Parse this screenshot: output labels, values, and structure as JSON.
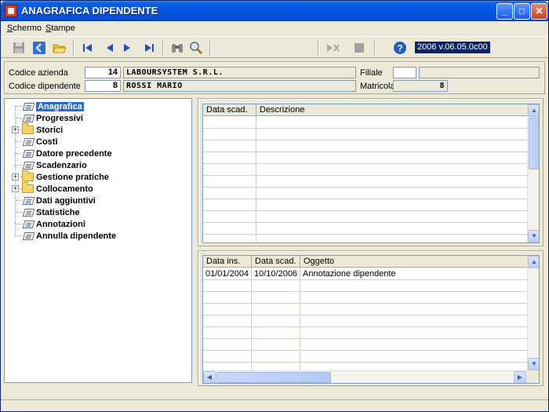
{
  "window": {
    "title": "ANAGRAFICA DIPENDENTE"
  },
  "menu": {
    "items": [
      {
        "label": "Schermo",
        "accel": "S",
        "rest": "chermo"
      },
      {
        "label": "Stampe",
        "accel": "S",
        "rest": "tampe"
      }
    ]
  },
  "toolbar": {
    "version": "2006 v.06.05.0c00"
  },
  "header": {
    "codice_azienda_label": "Codice azienda",
    "codice_azienda_value": "14",
    "azienda_name": "LABOURSYSTEM S.R.L.",
    "codice_dipendente_label": "Codice dipendente",
    "codice_dipendente_value": "8",
    "dipendente_name": "ROSSI MARIO",
    "filiale_label": "Filiale",
    "filiale_value": "",
    "filiale_desc": "",
    "matricola_label": "Matricola",
    "matricola_value": "8"
  },
  "tree": {
    "items": [
      {
        "label": "Anagrafica",
        "type": "doc",
        "selected": true
      },
      {
        "label": "Progressivi",
        "type": "doc"
      },
      {
        "label": "Storici",
        "type": "folder",
        "expandable": true
      },
      {
        "label": "Costi",
        "type": "doc"
      },
      {
        "label": "Datore precedente",
        "type": "doc"
      },
      {
        "label": "Scadenzario",
        "type": "doc"
      },
      {
        "label": "Gestione pratiche",
        "type": "folder",
        "expandable": true
      },
      {
        "label": "Collocamento",
        "type": "folder",
        "expandable": true
      },
      {
        "label": "Dati aggiuntivi",
        "type": "doc"
      },
      {
        "label": "Statistiche",
        "type": "doc"
      },
      {
        "label": "Annotazioni",
        "type": "doc"
      },
      {
        "label": "Annulla dipendente",
        "type": "doc"
      }
    ]
  },
  "grid_top": {
    "columns": [
      "Data scad.",
      "Descrizione"
    ],
    "rows": []
  },
  "grid_bottom": {
    "columns": [
      "Data ins.",
      "Data scad.",
      "Oggetto"
    ],
    "rows": [
      [
        "01/01/2004",
        "10/10/2006",
        "Annotazione dipendente"
      ]
    ]
  }
}
